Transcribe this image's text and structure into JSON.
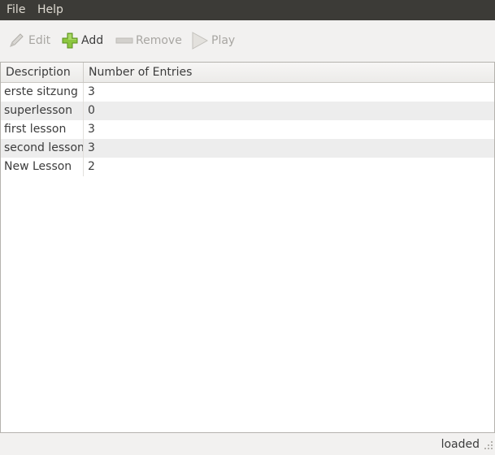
{
  "menu": {
    "file": "File",
    "help": "Help"
  },
  "toolbar": {
    "edit": {
      "label": "Edit",
      "icon": "pencil-icon",
      "enabled": false
    },
    "add": {
      "label": "Add",
      "icon": "plus-icon",
      "enabled": true
    },
    "remove": {
      "label": "Remove",
      "icon": "minus-icon",
      "enabled": false
    },
    "play": {
      "label": "Play",
      "icon": "play-icon",
      "enabled": false
    }
  },
  "table": {
    "columns": [
      "Description",
      "Number of Entries"
    ],
    "rows": [
      {
        "description": "erste sitzung",
        "entries": "3"
      },
      {
        "description": "superlesson",
        "entries": "0"
      },
      {
        "description": "first lesson",
        "entries": "3"
      },
      {
        "description": "second lesson",
        "entries": "3"
      },
      {
        "description": "New Lesson",
        "entries": "2"
      }
    ]
  },
  "status": {
    "text": "loaded"
  },
  "colors": {
    "menubar_bg": "#3c3b37",
    "add_icon": "#7dbb2b",
    "disabled_text": "#a8a6a2",
    "alt_row": "#ededed"
  }
}
